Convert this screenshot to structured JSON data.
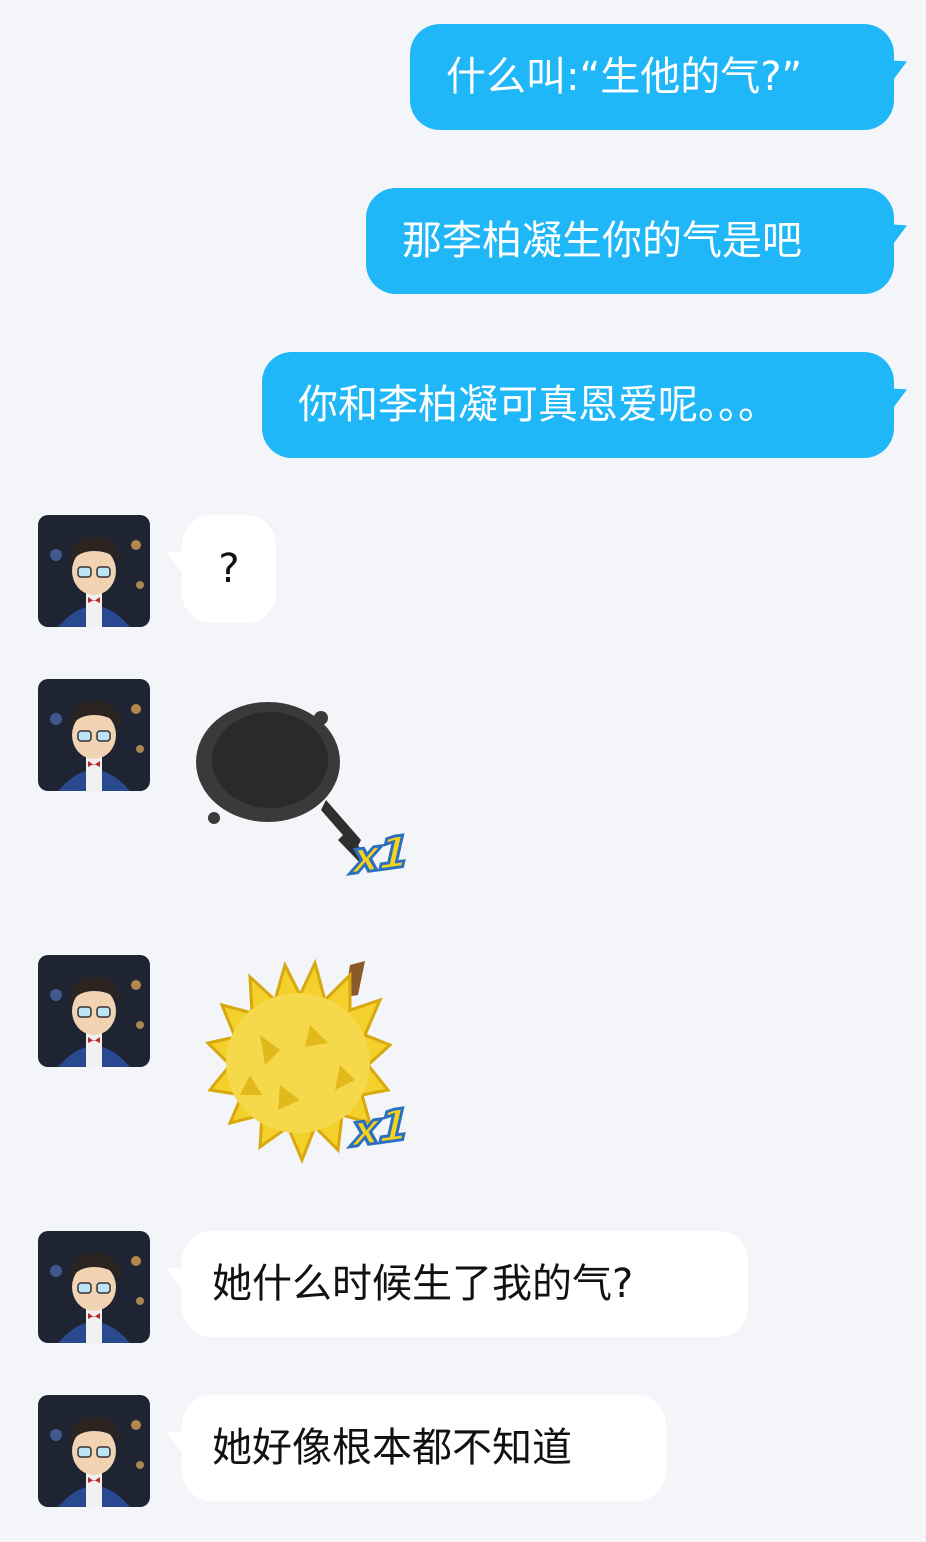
{
  "messages": {
    "out": [
      "什么叫:“生他的气?”",
      "那李柏凝生你的气是吧",
      "你和李柏凝可真恩爱呢。。。"
    ],
    "in": {
      "q": "?",
      "m1": "她什么时候生了我的气?",
      "m2": "她好像根本都不知道"
    }
  },
  "stickers": {
    "pan": {
      "icon": "frying-pan-icon",
      "count": "x1"
    },
    "durian": {
      "icon": "durian-icon",
      "count": "x1"
    }
  },
  "colors": {
    "outgoing_bubble": "#1fb7f8",
    "incoming_bubble": "#ffffff",
    "background": "#f3f5f9"
  }
}
